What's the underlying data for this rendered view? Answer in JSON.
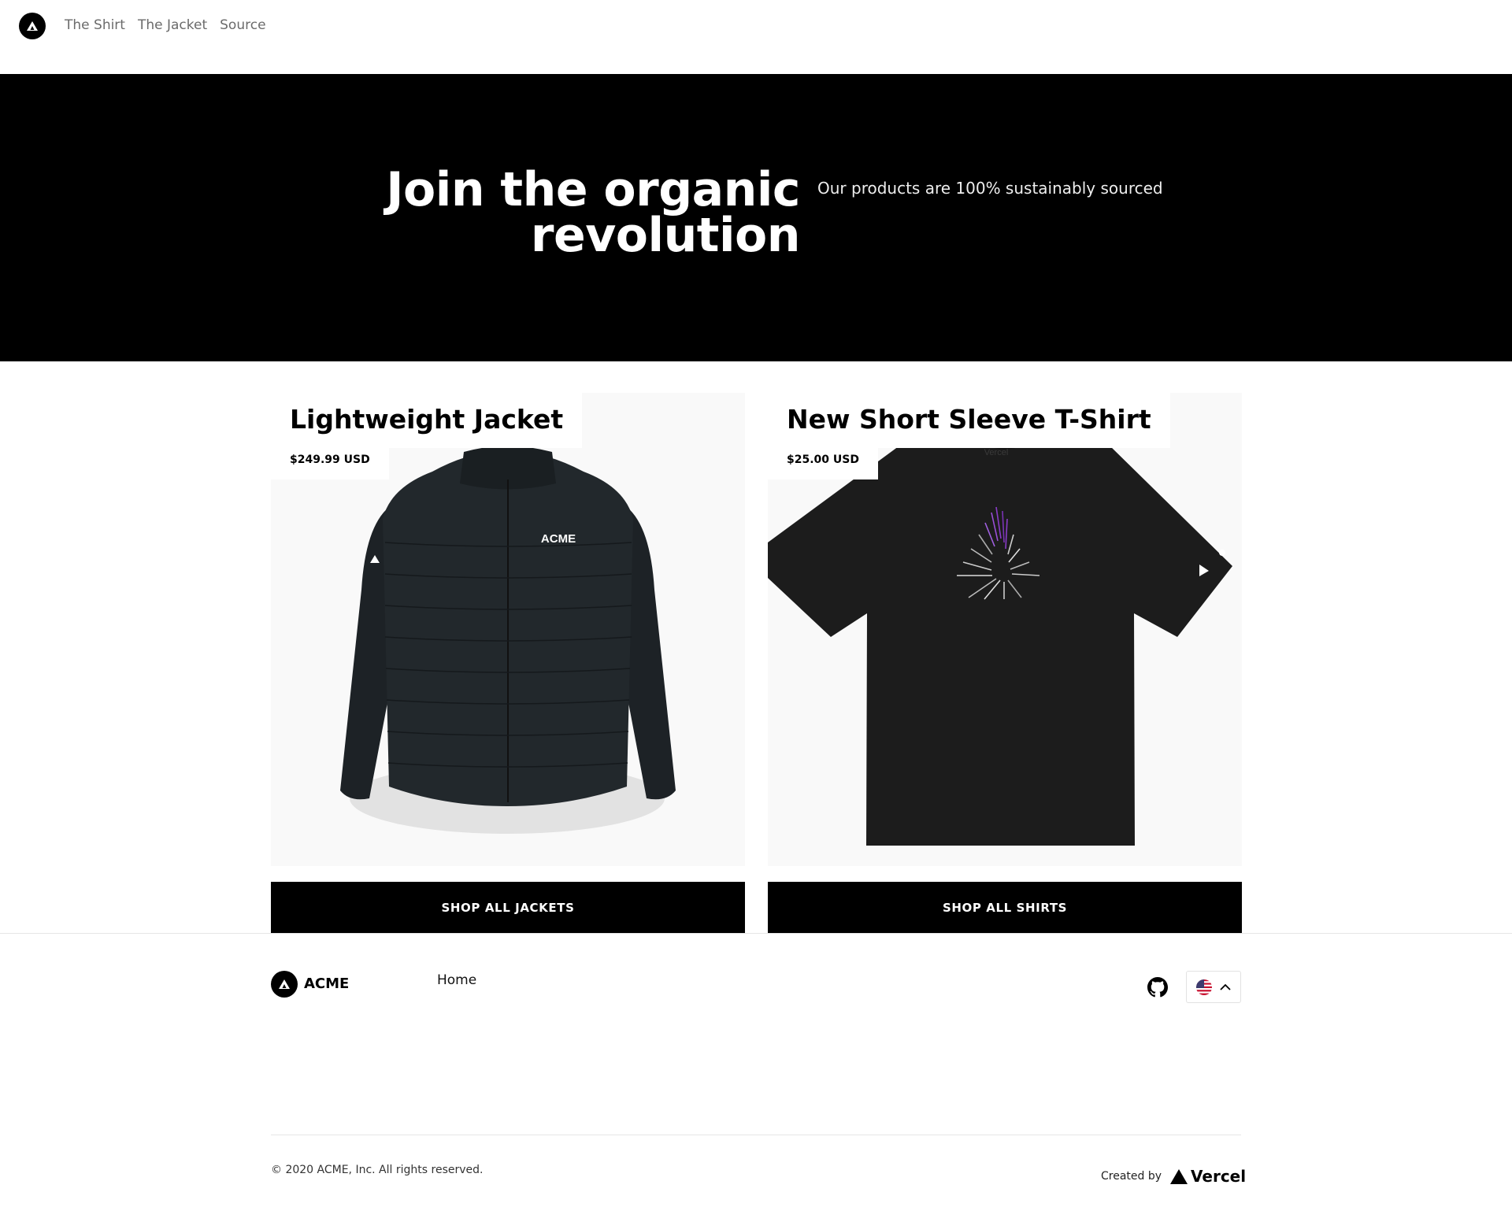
{
  "nav": {
    "items": [
      {
        "label": "The Shirt"
      },
      {
        "label": "The Jacket"
      },
      {
        "label": "Source"
      }
    ]
  },
  "hero": {
    "title_line1": "Join the organic",
    "title_line2": "revolution",
    "subtitle": "Our products are 100% sustainably sourced"
  },
  "products": [
    {
      "title": "Lightweight Jacket",
      "price": "$249.99 USD",
      "button": "SHOP ALL JACKETS",
      "brand_print": "ACME"
    },
    {
      "title": "New Short Sleeve T-Shirt",
      "price": "$25.00 USD",
      "button": "SHOP ALL SHIRTS",
      "brand_print": "Vercel"
    }
  ],
  "footer": {
    "brand": "ACME",
    "home_link": "Home",
    "copyright": "© 2020 ACME, Inc. All rights reserved.",
    "created_by": "Created by",
    "vercel": "Vercel",
    "locale_flag": "us-flag-icon"
  },
  "colors": {
    "hero_bg": "#000000",
    "button_bg": "#000000",
    "nav_link": "#6b6b6b",
    "shirt_print_accent": "#8a3cc9"
  }
}
